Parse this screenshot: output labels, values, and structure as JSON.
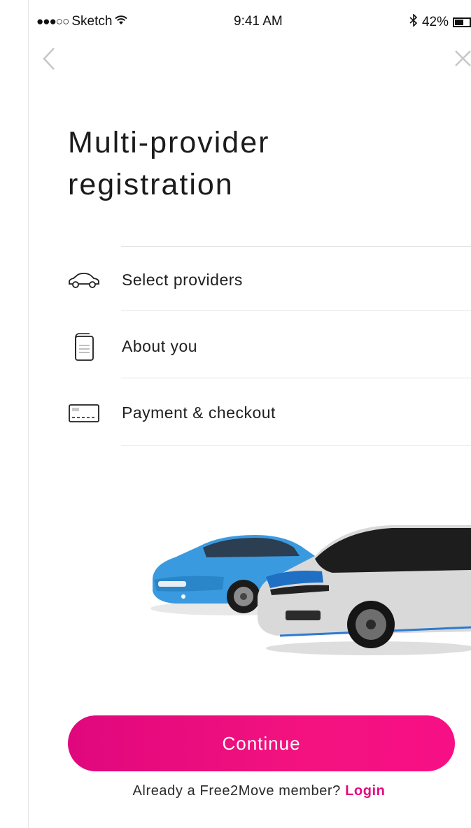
{
  "status_bar": {
    "carrier": "Sketch",
    "signal_dots": "●●●○○",
    "time": "9:41 AM",
    "battery": "42%",
    "icons": [
      "wifi-icon",
      "bluetooth-icon",
      "battery-icon"
    ]
  },
  "nav": {
    "back_icon": "chevron-left-icon",
    "close_icon": "close-icon"
  },
  "title": {
    "line1": "Multi-provider",
    "line2": "registration"
  },
  "steps": [
    {
      "label": "Select providers",
      "icon": "car-icon"
    },
    {
      "label": "About you",
      "icon": "document-icon"
    },
    {
      "label": "Payment & checkout",
      "icon": "card-icon"
    }
  ],
  "illustration": "cars-illustration",
  "continue_label": "Continue",
  "login": {
    "prompt": "Already a Free2Move member?",
    "link": "Login"
  },
  "colors": {
    "accent": "#e4077f",
    "button_gradient_start": "#e0077e",
    "button_gradient_end": "#f70f86"
  }
}
